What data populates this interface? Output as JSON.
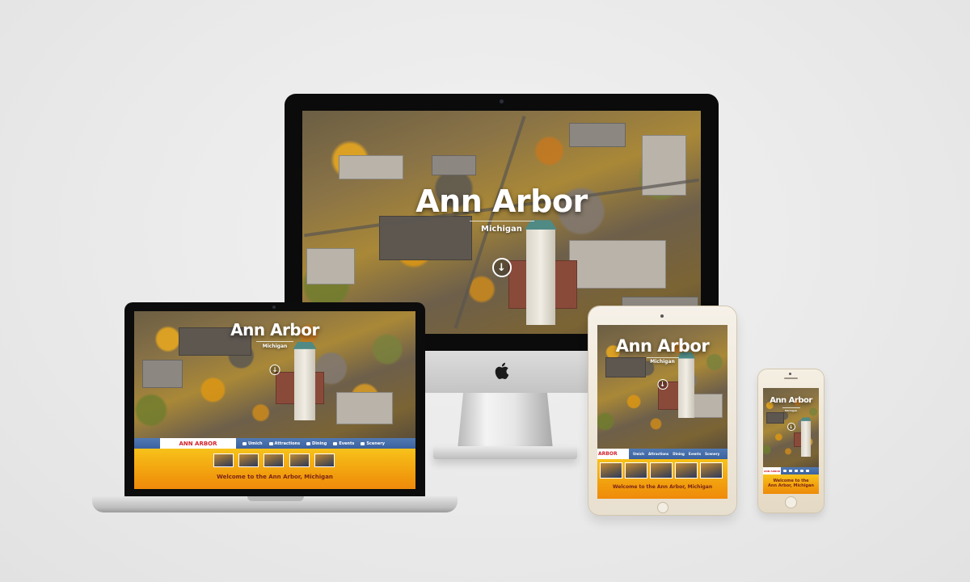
{
  "site": {
    "title": "Ann Arbor",
    "subtitle": "Michigan",
    "brand": "ANN ARBOR",
    "brand_cropped": "ARBOR",
    "welcome": "Welcome to the Ann Arbor, Michigan",
    "welcome_line1": "Welcome to the",
    "welcome_line2": "Ann Arbor, Michigan"
  },
  "nav": {
    "items": [
      {
        "label": "Umich"
      },
      {
        "label": "Attractions"
      },
      {
        "label": "Dining"
      },
      {
        "label": "Events"
      },
      {
        "label": "Scenery"
      }
    ]
  },
  "icons": {
    "scroll_down": "arrow-down-circle-icon",
    "apple_logo": "apple-logo"
  },
  "colors": {
    "nav_blue": "#3b629e",
    "brand_red": "#d2232a",
    "panel_yellow": "#f7c21a",
    "panel_orange": "#ef8a0b",
    "welcome_text": "#7a2415"
  }
}
